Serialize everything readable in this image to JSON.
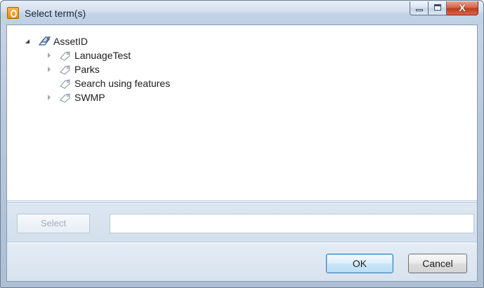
{
  "window": {
    "title": "Select term(s)",
    "icon": "outlook-app-icon",
    "minimize_icon": "minimize-icon",
    "maximize_icon": "maximize-icon",
    "close_glyph": "X"
  },
  "tree": {
    "root": {
      "label": "AssetID",
      "icon": "term-set-icon",
      "expanded": true
    },
    "children": [
      {
        "label": "LanuageTest",
        "icon": "tag-icon",
        "has_children": true
      },
      {
        "label": "Parks",
        "icon": "tag-icon",
        "has_children": true
      },
      {
        "label": "Search using features",
        "icon": "tag-icon",
        "has_children": false
      },
      {
        "label": "SWMP",
        "icon": "tag-icon",
        "has_children": true
      }
    ]
  },
  "select_bar": {
    "select_label": "Select",
    "select_enabled": false,
    "input_value": ""
  },
  "footer": {
    "ok_label": "OK",
    "cancel_label": "Cancel"
  },
  "colors": {
    "frame": "#b9c9dc",
    "select_bar": "#d8e3ef",
    "close_button": "#c9452c",
    "ok_focus_border": "#3c7fb1"
  }
}
